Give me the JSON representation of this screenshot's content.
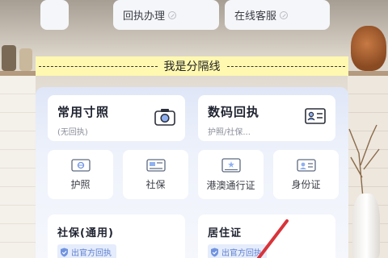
{
  "top": {
    "left_label": "回执办理",
    "right_label": "在线客服"
  },
  "divider_text": "我是分隔线",
  "main_cards": [
    {
      "title": "常用寸照",
      "sub": "(无回执)",
      "icon": "camera-icon"
    },
    {
      "title": "数码回执",
      "sub": "护照/社保...",
      "icon": "id-card-icon"
    }
  ],
  "small_cards": [
    {
      "label": "护照",
      "icon": "passport-icon"
    },
    {
      "label": "社保",
      "icon": "social-security-card-icon"
    },
    {
      "label": "港澳通行证",
      "icon": "travel-permit-icon"
    },
    {
      "label": "身份证",
      "icon": "id-card-icon"
    }
  ],
  "bottom_cards": [
    {
      "title": "社保(通用)",
      "badge": "出官方回执"
    },
    {
      "title": "居住证",
      "badge": "出官方回执"
    }
  ],
  "colors": {
    "accent": "#5e7fd1",
    "badge_bg": "#e5ecfb",
    "divider_bg": "#fff8b0",
    "annotation": "#d9333a"
  }
}
